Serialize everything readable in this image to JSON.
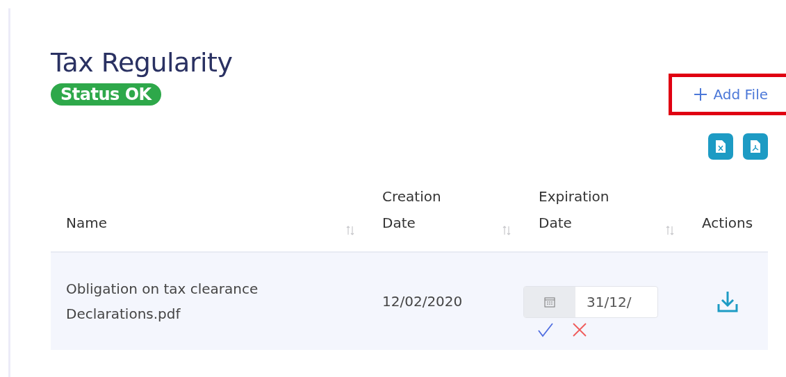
{
  "title": "Tax Regularity",
  "status_badge": {
    "label": "Status OK",
    "kind": "ok"
  },
  "add_file_button": {
    "label": "Add File",
    "highlighted": true
  },
  "export_buttons": [
    {
      "kind": "excel"
    },
    {
      "kind": "pdf"
    }
  ],
  "table": {
    "headers": [
      {
        "label": "Name",
        "sortable": true
      },
      {
        "label": "Creation\nDate",
        "sortable": true
      },
      {
        "label": "Expiration\nDate",
        "sortable": true
      },
      {
        "label": "Actions",
        "sortable": false
      }
    ],
    "rows": [
      {
        "name": "Obligation on tax clearance\nDeclarations.pdf",
        "creation_date": "12/02/2020",
        "expiration_date": "31/12/",
        "editing": true
      }
    ]
  }
}
